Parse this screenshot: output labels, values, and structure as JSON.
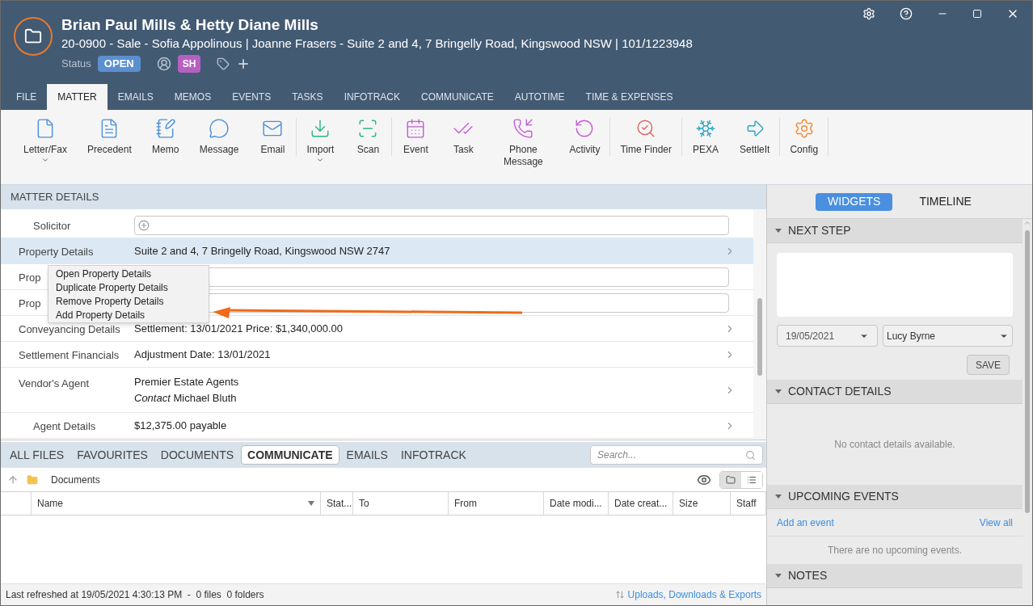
{
  "header": {
    "title": "Brian Paul Mills & Hetty Diane Mills",
    "subtitle": "20-0900 - Sale - Sofia Appolinous | Joanne Frasers - Suite 2 and 4, 7 Bringelly Road, Kingswood NSW | 101/1223948",
    "status_label": "Status",
    "status": "OPEN",
    "staff_initials": "SH"
  },
  "menu_tabs": [
    {
      "label": "FILE",
      "selected": false
    },
    {
      "label": "MATTER",
      "selected": true
    },
    {
      "label": "EMAILS",
      "selected": false
    },
    {
      "label": "MEMOS",
      "selected": false
    },
    {
      "label": "EVENTS",
      "selected": false
    },
    {
      "label": "TASKS",
      "selected": false
    },
    {
      "label": "INFOTRACK",
      "selected": false
    },
    {
      "label": "COMMUNICATE",
      "selected": false
    },
    {
      "label": "AUTOTIME",
      "selected": false
    },
    {
      "label": "TIME & EXPENSES",
      "selected": false
    }
  ],
  "ribbon": [
    {
      "kind": "letter",
      "label": "Letter/Fax",
      "dropdown": true,
      "divider_after": false
    },
    {
      "kind": "precedent",
      "label": "Precedent",
      "dropdown": false,
      "divider_after": false
    },
    {
      "kind": "memo",
      "label": "Memo",
      "dropdown": false,
      "divider_after": false
    },
    {
      "kind": "message",
      "label": "Message",
      "dropdown": false,
      "divider_after": false
    },
    {
      "kind": "email",
      "label": "Email",
      "dropdown": false,
      "divider_after": true
    },
    {
      "kind": "import",
      "label": "Import",
      "dropdown": true,
      "divider_after": false
    },
    {
      "kind": "scan",
      "label": "Scan",
      "dropdown": false,
      "divider_after": true
    },
    {
      "kind": "event",
      "label": "Event",
      "dropdown": false,
      "divider_after": false
    },
    {
      "kind": "task",
      "label": "Task",
      "dropdown": false,
      "divider_after": false
    },
    {
      "kind": "phone",
      "label": "Phone Message",
      "dropdown": false,
      "divider_after": false
    },
    {
      "kind": "activity",
      "label": "Activity",
      "dropdown": false,
      "divider_after": true
    },
    {
      "kind": "timefinder",
      "label": "Time Finder",
      "dropdown": false,
      "divider_after": true
    },
    {
      "kind": "pexa",
      "label": "PEXA",
      "dropdown": false,
      "divider_after": false
    },
    {
      "kind": "settleit",
      "label": "SettleIt",
      "dropdown": false,
      "divider_after": true
    },
    {
      "kind": "config",
      "label": "Config",
      "dropdown": false,
      "divider_after": true
    }
  ],
  "matter_details": {
    "title": "MATTER DETAILS",
    "rows": [
      {
        "kind": "sub-empty",
        "label": "Solicitor",
        "selected": false
      },
      {
        "kind": "value",
        "label": "Property Details",
        "value": "Suite 2 and 4, 7 Bringelly Road, Kingswood NSW 2747",
        "selected": true
      },
      {
        "kind": "empty",
        "label": "Prop",
        "selected": false
      },
      {
        "kind": "empty",
        "label": "Prop",
        "selected": false
      },
      {
        "kind": "value",
        "label": "Conveyancing Details",
        "value": "Settlement: 13/01/2021 Price: $1,340,000.00",
        "selected": false
      },
      {
        "kind": "value",
        "label": "Settlement Financials",
        "value": "Adjustment Date: 13/01/2021",
        "selected": false
      },
      {
        "kind": "contact",
        "label": "Vendor's Agent",
        "value": "Premier Estate Agents",
        "contact_label": "Contact",
        "contact_name": "Michael Bluth",
        "selected": false,
        "children": [
          {
            "kind": "value",
            "label": "Agent Details",
            "value": "$12,375.00 payable",
            "selected": false
          }
        ]
      }
    ]
  },
  "context_menu": [
    "Open Property Details",
    "Duplicate Property Details",
    "Remove Property Details",
    "Add Property Details"
  ],
  "files": {
    "tabs": [
      {
        "label": "ALL FILES",
        "selected": false
      },
      {
        "label": "FAVOURITES",
        "selected": false
      },
      {
        "label": "DOCUMENTS",
        "selected": false
      },
      {
        "label": "COMMUNICATE",
        "selected": true
      },
      {
        "label": "EMAILS",
        "selected": false
      },
      {
        "label": "INFOTRACK",
        "selected": false
      }
    ],
    "search_placeholder": "Search...",
    "folder": "Documents",
    "views": [
      {
        "kind": "folder",
        "selected": true
      },
      {
        "kind": "list",
        "selected": false
      }
    ],
    "columns": [
      "Name",
      "Stat...",
      "To",
      "From",
      "Date modi...",
      "Date creat...",
      "Size",
      "Staff"
    ],
    "status": "Last refreshed at 19/05/2021 4:30:13 PM  -  0 files  0 folders",
    "link": "Uploads, Downloads & Exports"
  },
  "side": {
    "tabs": [
      {
        "label": "WIDGETS",
        "selected": true
      },
      {
        "label": "TIMELINE",
        "selected": false
      }
    ],
    "next_step": {
      "title": "NEXT STEP",
      "date": "19/05/2021",
      "person": "Lucy Byrne",
      "save": "SAVE"
    },
    "contact": {
      "title": "CONTACT DETAILS",
      "empty": "No contact details available."
    },
    "events": {
      "title": "UPCOMING EVENTS",
      "add": "Add an event",
      "view_all": "View all",
      "empty": "There are no upcoming events."
    },
    "notes": {
      "title": "NOTES"
    }
  }
}
